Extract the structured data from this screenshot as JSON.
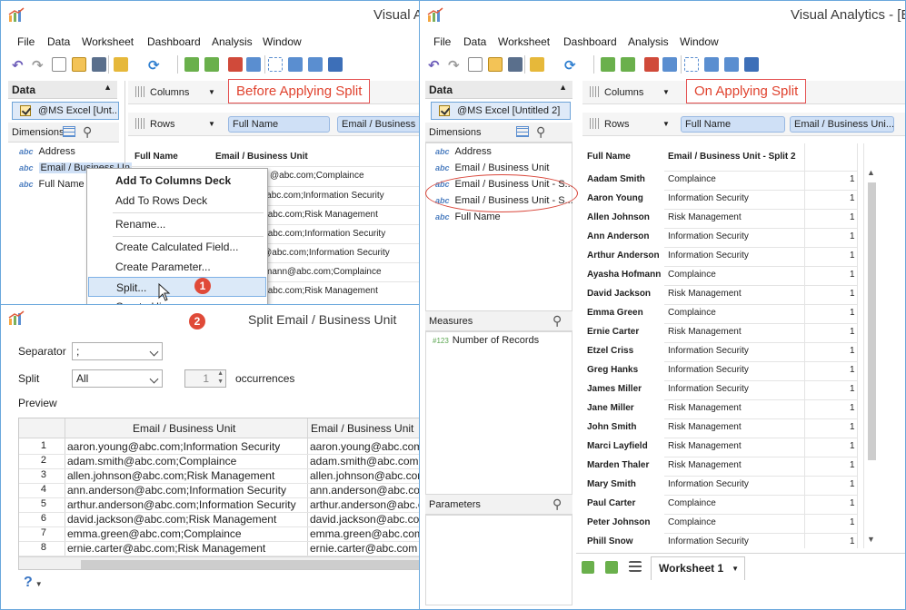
{
  "colors": {
    "accent": "#e0432f",
    "window_border": "#6aa8dc",
    "pill": "#cfe0f6",
    "selection": "#dfeaf8"
  },
  "left_window": {
    "title": "Visual Ar",
    "menu": [
      "File",
      "Data",
      "Worksheet",
      "Dashboard",
      "Analysis",
      "Window"
    ],
    "data_panel_title": "Data",
    "data_source": "@MS Excel [Unt...",
    "dimensions_label": "Dimensions",
    "fields": [
      "Address",
      "Email / Business Un",
      "Full Name"
    ],
    "columns_label": "Columns",
    "rows_label": "Rows",
    "row_pills": [
      "Full Name",
      "Email / Business U"
    ],
    "callout": "Before Applying Split",
    "grid_headers": [
      "Full Name",
      "Email / Business Unit"
    ],
    "grid_values": [
      "@abc.com;Complaince",
      "@abc.com;Information Security",
      "n@abc.com;Risk Management",
      "n@abc.com;Information Security",
      "son@abc.com;Information Security",
      "mann@abc.com;Complaince",
      "n@abc.com;Risk Management"
    ],
    "context_menu": [
      "Add To Columns Deck",
      "Add To Rows Deck",
      "Rename...",
      "Create Calculated Field...",
      "Create Parameter...",
      "Split...",
      "Create Hie..."
    ],
    "badge_1": "1"
  },
  "dialog": {
    "title": "Split Email / Business Unit",
    "badge_2": "2",
    "separator_label": "Separator",
    "separator_value": ";",
    "split_label": "Split",
    "split_value": "All",
    "occurrences_value": "1",
    "occurrences_label": "occurrences",
    "preview_label": "Preview",
    "preview_headers": [
      "Email / Business Unit",
      "Email / Business Unit"
    ],
    "preview_rows": [
      {
        "n": "1",
        "a": "aaron.young@abc.com;Information Security",
        "b": "aaron.young@abc.com"
      },
      {
        "n": "2",
        "a": "adam.smith@abc.com;Complaince",
        "b": "adam.smith@abc.com"
      },
      {
        "n": "3",
        "a": "allen.johnson@abc.com;Risk Management",
        "b": "allen.johnson@abc.com"
      },
      {
        "n": "4",
        "a": "ann.anderson@abc.com;Information Security",
        "b": "ann.anderson@abc.com"
      },
      {
        "n": "5",
        "a": "arthur.anderson@abc.com;Information Security",
        "b": "arthur.anderson@abc.com"
      },
      {
        "n": "6",
        "a": "david.jackson@abc.com;Risk Management",
        "b": "david.jackson@abc.com"
      },
      {
        "n": "7",
        "a": "emma.green@abc.com;Complaince",
        "b": "emma.green@abc.com"
      },
      {
        "n": "8",
        "a": "ernie.carter@abc.com;Risk Management",
        "b": "ernie.carter@abc.com"
      }
    ],
    "help": "?"
  },
  "right_window": {
    "title": "Visual Analytics - [E",
    "menu": [
      "File",
      "Data",
      "Worksheet",
      "Dashboard",
      "Analysis",
      "Window"
    ],
    "data_panel_title": "Data",
    "data_source": "@MS Excel [Untitled 2]",
    "dimensions_label": "Dimensions",
    "fields": [
      "Address",
      "Email / Business Unit",
      "Email / Business Unit - S...",
      "Email / Business Unit - S...",
      "Full Name"
    ],
    "measures_label": "Measures",
    "measure_field": "Number of Records",
    "measure_prefix": "#123",
    "parameters_label": "Parameters",
    "columns_label": "Columns",
    "rows_label": "Rows",
    "row_pills": [
      "Full Name",
      "Email / Business Uni..."
    ],
    "callout": "On Applying Split",
    "grid_headers": [
      "Full Name",
      "Email / Business Unit - Split 2"
    ],
    "rows": [
      {
        "name": "Aadam Smith",
        "unit": "Complaince",
        "count": "1"
      },
      {
        "name": "Aaron Young",
        "unit": "Information Security",
        "count": "1"
      },
      {
        "name": "Allen Johnson",
        "unit": "Risk Management",
        "count": "1"
      },
      {
        "name": "Ann Anderson",
        "unit": "Information Security",
        "count": "1"
      },
      {
        "name": "Arthur Anderson",
        "unit": "Information Security",
        "count": "1"
      },
      {
        "name": "Ayasha Hofmann",
        "unit": "Complaince",
        "count": "1"
      },
      {
        "name": "David Jackson",
        "unit": "Risk Management",
        "count": "1"
      },
      {
        "name": "Emma Green",
        "unit": "Complaince",
        "count": "1"
      },
      {
        "name": "Ernie Carter",
        "unit": "Risk Management",
        "count": "1"
      },
      {
        "name": "Etzel Criss",
        "unit": "Information Security",
        "count": "1"
      },
      {
        "name": "Greg Hanks",
        "unit": "Information Security",
        "count": "1"
      },
      {
        "name": "James Miller",
        "unit": "Information Security",
        "count": "1"
      },
      {
        "name": "Jane Miller",
        "unit": "Risk Management",
        "count": "1"
      },
      {
        "name": "John Smith",
        "unit": "Risk Management",
        "count": "1"
      },
      {
        "name": "Marci Layfield",
        "unit": "Risk Management",
        "count": "1"
      },
      {
        "name": "Marden Thaler",
        "unit": "Risk Management",
        "count": "1"
      },
      {
        "name": "Mary Smith",
        "unit": "Information Security",
        "count": "1"
      },
      {
        "name": "Paul Carter",
        "unit": "Complaince",
        "count": "1"
      },
      {
        "name": "Peter Johnson",
        "unit": "Complaince",
        "count": "1"
      },
      {
        "name": "Phill Snow",
        "unit": "Information Security",
        "count": "1"
      }
    ],
    "worksheet_tab": "Worksheet 1"
  }
}
